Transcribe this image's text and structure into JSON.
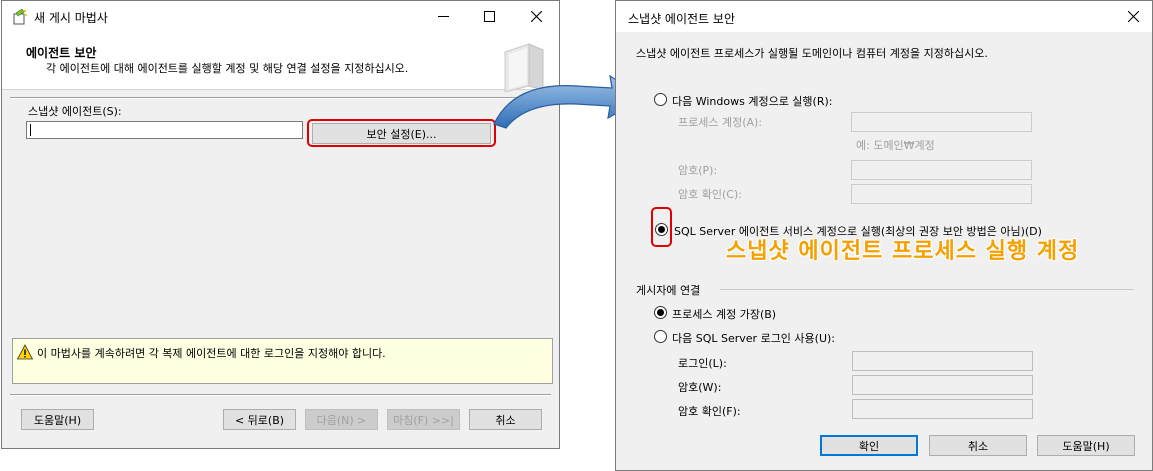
{
  "wizard": {
    "title": "새 게시 마법사",
    "header_title": "에이전트 보안",
    "header_subtitle": "각 에이전트에 대해 에이전트를 실행할 계정 및 해당 연결 설정을 지정하십시오.",
    "agent_label": "스냅샷 에이전트(S):",
    "agent_value": "",
    "security_button": "보안 설정(E)...",
    "warning_text": "이 마법사를 계속하려면 각 복제 에이전트에 대한 로그인을 지정해야 합니다.",
    "buttons": {
      "help": "도움말(H)",
      "back": "< 뒤로(B)",
      "next": "다음(N) >",
      "finish": "마침(F) >>|",
      "cancel": "취소"
    }
  },
  "dialog": {
    "title": "스냅샷 에이전트 보안",
    "description": "스냅샷 에이전트 프로세스가 실행될 도메인이나 컴퓨터 계정을 지정하십시오.",
    "windows_account_option": "다음 Windows 계정으로 실행(R):",
    "process_account_label": "프로세스 계정(A):",
    "process_account_example": "예: 도메인₩계정",
    "password_label": "암호(P):",
    "confirm_password_label": "암호 확인(C):",
    "sql_agent_option": "SQL Server 에이전트 서비스 계정으로 실행(최상의 권장 보안 방법은 아님)(D)",
    "overlay_annotation": "스냅샷 에이전트 프로세스 실행 계정",
    "publisher_group_label": "게시자에 연결",
    "impersonate_option": "프로세스 계정 가장(B)",
    "sql_login_option": "다음 SQL Server 로그인 사용(U):",
    "login_label": "로그인(L):",
    "password2_label": "암호(W):",
    "confirm_password2_label": "암호 확인(F):",
    "buttons": {
      "ok": "확인",
      "cancel": "취소",
      "help": "도움말(H)"
    },
    "selected": {
      "run_as": "sql_agent",
      "connect": "impersonate"
    }
  },
  "colors": {
    "highlight_red": "#e00000",
    "arrow_blue": "#3a78c2",
    "annotation_orange": "#f5a000",
    "warning_bg": "#ffffe1"
  }
}
